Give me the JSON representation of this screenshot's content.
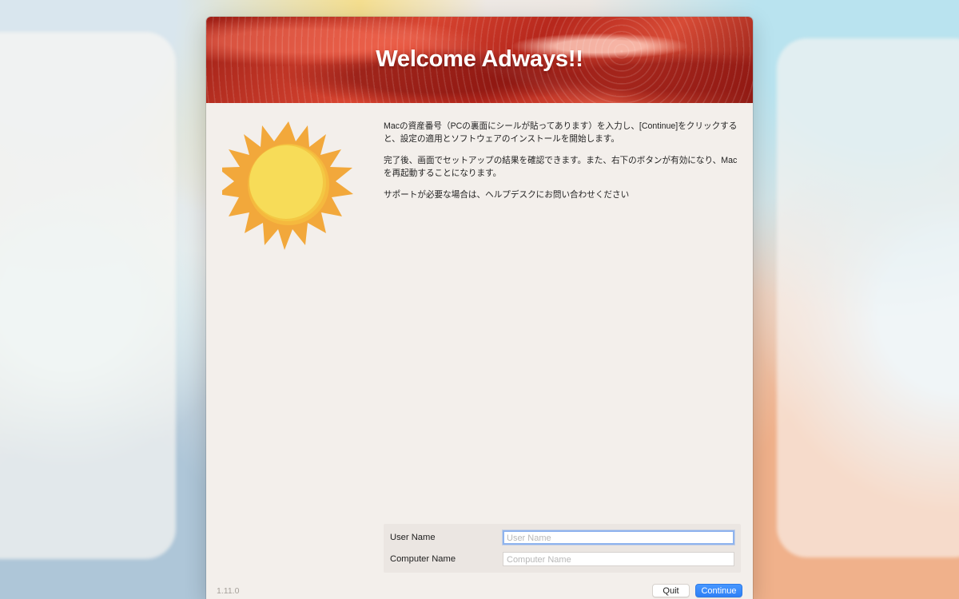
{
  "window": {
    "title": "Welcome Adways!!",
    "version": "1.11.0"
  },
  "icons": {
    "sun": "sun-icon"
  },
  "intro": {
    "paragraphs": [
      "Macの資産番号（PCの裏面にシールが貼ってあります）を入力し、[Continue]をクリックすると、設定の適用とソフトウェアのインストールを開始します。",
      "完了後、画面でセットアップの結果を確認できます。また、右下のボタンが有効になり、Macを再起動することになります。",
      "サポートが必要な場合は、ヘルプデスクにお問い合わせください"
    ]
  },
  "form": {
    "user_name": {
      "label": "User Name",
      "placeholder": "User Name",
      "value": ""
    },
    "computer_name": {
      "label": "Computer Name",
      "placeholder": "Computer Name",
      "value": ""
    }
  },
  "buttons": {
    "quit": "Quit",
    "continue": "Continue"
  },
  "colors": {
    "accent": "#3b89f8",
    "header_red": "#c53526",
    "sun_outer": "#f2a83b",
    "sun_inner": "#f8dc58"
  }
}
